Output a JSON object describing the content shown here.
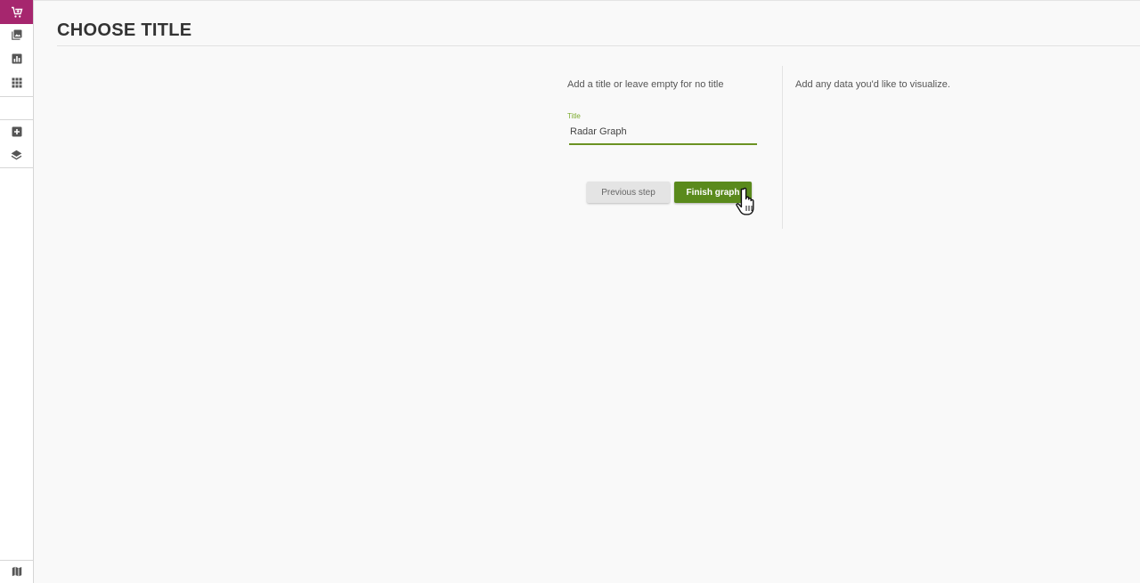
{
  "sidebar": {
    "items": [
      {
        "icon": "cart-add-icon",
        "active": true
      },
      {
        "icon": "image-icon",
        "active": false
      },
      {
        "icon": "bar-chart-icon",
        "active": false
      },
      {
        "icon": "grid-icon",
        "active": false
      },
      {
        "icon": "add-box-icon",
        "active": false
      },
      {
        "icon": "layers-icon",
        "active": false
      }
    ],
    "bottom_icon": "map-icon",
    "accent_color": "#a6266e"
  },
  "page": {
    "title": "CHOOSE TITLE"
  },
  "form": {
    "instruction": "Add a title or leave empty for no title",
    "field_label": "Title",
    "field_value": "Radar Graph",
    "previous_label": "Previous step",
    "finish_label": "Finish graph",
    "primary_color": "#5a8a1c"
  },
  "side_panel": {
    "text": "Add any data you'd like to visualize."
  }
}
